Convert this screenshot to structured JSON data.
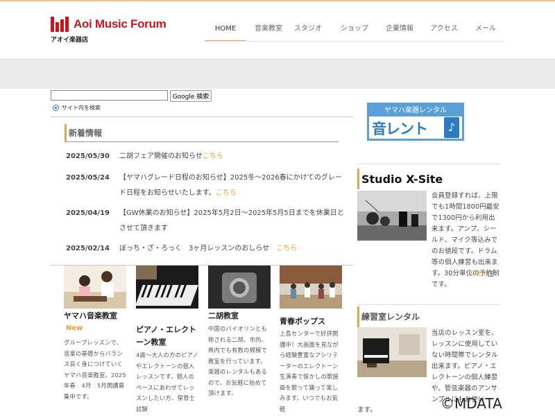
{
  "header": {
    "logo_title": "Aoi Music Forum",
    "logo_sub": "アオイ楽器店",
    "nav": [
      "HOME",
      "音楽教室",
      "スタジオ",
      "ショップ",
      "企業情報",
      "アクセス",
      "メール"
    ],
    "active_nav": "HOME"
  },
  "search": {
    "input_value": "",
    "button_label": "Google 検索",
    "radio_label": "サイト内を検索"
  },
  "news": {
    "heading": "新着情報",
    "link_label": "こちら",
    "items": [
      {
        "date": "2025/05/30",
        "text": "二胡フェア開催のお知らせ"
      },
      {
        "date": "2025/05/24",
        "text": "【ヤマハグレード日程のお知らせ】2025冬～2026春にかけてのグレード日程をお知らせいたします。"
      },
      {
        "date": "2025/04/19",
        "text": "【GW休業のお知らせ】2025年5月2日～2025年5月5日までを休業日とさせて頂きます"
      },
      {
        "date": "2025/02/14",
        "text": "ぼっち・ざ・ろっく　3ヶ月レッスンのおしらせ　"
      }
    ]
  },
  "cards": [
    {
      "title": "ヤマハ音楽教室",
      "badge": "New",
      "desc": "グループレッスンで、音楽の基礎からバランス良く身につけていくヤマハ音楽教室。2025年春　4月　5月開講募集中です。"
    },
    {
      "title": "ピアノ・エレクトーン教室",
      "desc": "4歳～大人の方のピアノやエレクトーンの個人レッスンです。個人のペースにあわせてレッスンしたい方、保育士試験"
    },
    {
      "title": "二胡教室",
      "desc": "中国のバイオリンとも称される二胡。市内、県内でも有数の規模で教室を行っています。楽器のレンタルもあるので、お気軽に始めて頂けます。"
    },
    {
      "title": "青春ポップス",
      "desc": "上島センターで好評開講中！大画面を見ながら経験豊富なアシリテーターのエレクトーン生演奏で懐かしの歌謡曲を歌って踊って楽しみます。いつでもお気軽"
    }
  ],
  "sidebar": {
    "rental_banner_top": "ヤマハ楽器レンタル",
    "rental_banner_logo": "音レント",
    "rental_banner_note": "♪",
    "studio": {
      "heading": "Studio X-Site",
      "text": "会員登録すれば、上限でも1時間1800円最安で1300円から利用出来ます。アンプ、シールド、マイク等込みでのお値段です。ドラム等の個人練習も出来ます。30分単位の予約制です。",
      "link_label": "こちら",
      "link_icon": "external-link-icon",
      "link_icon_glyph": "↗"
    },
    "practice": {
      "heading": "練習室レンタル",
      "text": "当店のレッスン室を、レッスンに使用していない時間帯でレンタル出来ます。ピアノ・エレクトーンの個人練習や、管弦楽器のアンサンブルにもお使い",
      "text_tail": "ます。"
    }
  },
  "watermark": "©MDATA",
  "colors": {
    "accent_orange": "#f19c36",
    "heading_border": "#e7a25a",
    "logo_red": "#d0121b",
    "rental_blue": "#5aa0d6"
  }
}
